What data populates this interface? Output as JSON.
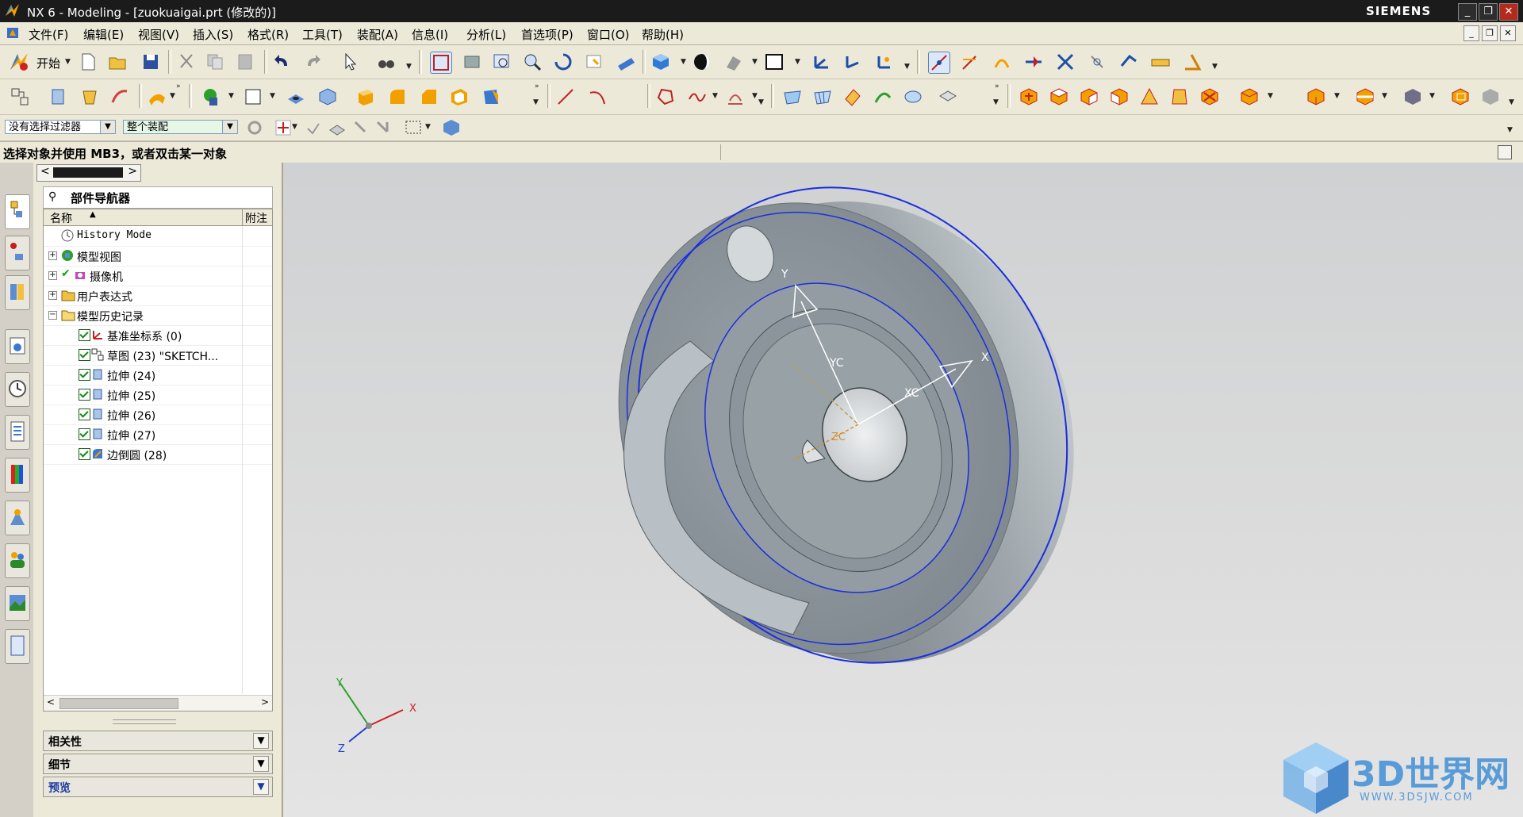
{
  "window": {
    "title": "NX 6 - Modeling - [zuokuaigai.prt (修改的)]",
    "brand": "SIEMENS",
    "controls": [
      "_",
      "❐",
      "✕"
    ]
  },
  "menu": {
    "items": [
      "文件(F)",
      "编辑(E)",
      "视图(V)",
      "插入(S)",
      "格式(R)",
      "工具(T)",
      "装配(A)",
      "信息(I)",
      "分析(L)",
      "首选项(P)",
      "窗口(O)",
      "帮助(H)"
    ]
  },
  "toolbar": {
    "start_label": "开始",
    "text_tool": "A"
  },
  "filters": {
    "selection_filter": "没有选择过滤器",
    "scope": "整个装配"
  },
  "status": {
    "prompt": "选择对象并使用 MB3，或者双击某一对象"
  },
  "navigator": {
    "title": "部件导航器",
    "col_name": "名称",
    "col_note": "附注",
    "rows": [
      {
        "label": "History Mode"
      },
      {
        "label": "模型视图"
      },
      {
        "label": "摄像机"
      },
      {
        "label": "用户表达式"
      },
      {
        "label": "模型历史记录"
      },
      {
        "label": "基准坐标系 (0)"
      },
      {
        "label": "草图 (23) \"SKETCH..."
      },
      {
        "label": "拉伸 (24)"
      },
      {
        "label": "拉伸 (25)"
      },
      {
        "label": "拉伸 (26)"
      },
      {
        "label": "拉伸 (27)"
      },
      {
        "label": "边倒圆 (28)"
      }
    ],
    "panels": [
      "相关性",
      "细节",
      "预览"
    ]
  },
  "viewport": {
    "triad": {
      "x": "X",
      "y": "Y",
      "z": "Z"
    },
    "wcs": {
      "x": "X",
      "y": "Y",
      "xc": "XC",
      "yc": "YC",
      "zc": "ZC"
    },
    "watermark": {
      "main": "3D世界网",
      "url": "WWW.3DSJW.COM"
    }
  },
  "colors": {
    "selection_blue": "#1a2ee0",
    "part_gray": "#8d979d",
    "title_bar": "#1b1b1b",
    "watermark_blue": "#3f8fd8"
  }
}
